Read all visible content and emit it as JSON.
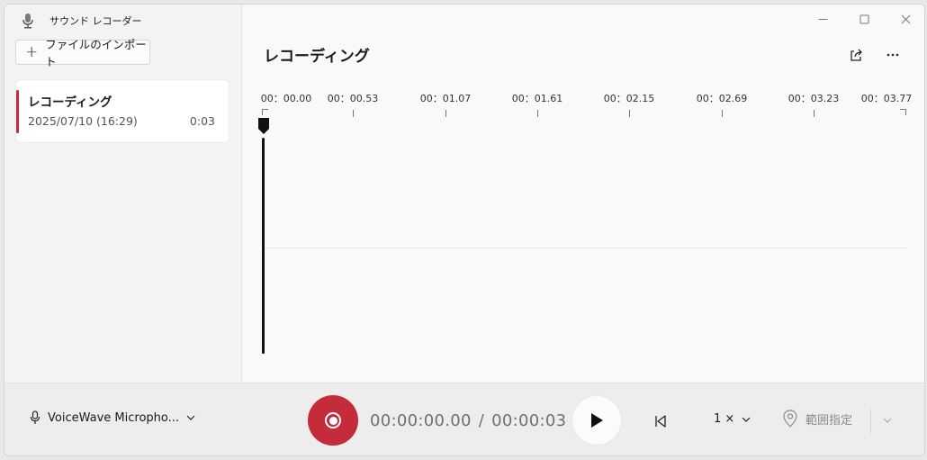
{
  "app": {
    "title": "サウンド レコーダー",
    "icon": "microphone-app-icon"
  },
  "sidebar": {
    "import_label": "ファイルのインポート",
    "recordings": [
      {
        "name": "レコーディング",
        "date": "2025/07/10 (16:29)",
        "duration": "0:03"
      }
    ]
  },
  "main": {
    "title": "レコーディング",
    "timeline_ticks": [
      "00：00.00",
      "00：00.53",
      "00：01.07",
      "00：01.61",
      "00：02.15",
      "00：02.69",
      "00：03.23",
      "00：03.77"
    ]
  },
  "bottom": {
    "mic_label": "VoiceWave Micropho...",
    "current_time": "00:00:00.00",
    "separator": "/",
    "total_time": "00:00:03",
    "speed_label": "1 ×",
    "mark_label": "範囲指定"
  },
  "colors": {
    "accent": "#c42b3b"
  }
}
